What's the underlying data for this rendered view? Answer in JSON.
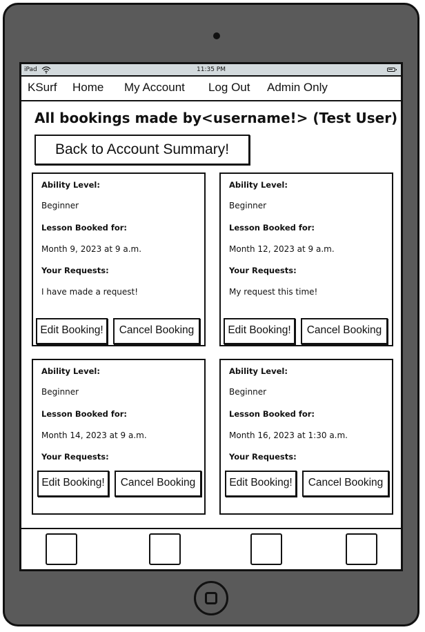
{
  "status_bar": {
    "device": "iPad",
    "time": "11:35 PM"
  },
  "nav": {
    "items": [
      "KSurf",
      "Home",
      "My Account",
      "Log Out",
      "Admin Only"
    ]
  },
  "page": {
    "title": "All bookings made by<username!> (Test User)",
    "back_button": "Back to Account Summary!"
  },
  "labels": {
    "ability": "Ability Level:",
    "lesson": "Lesson Booked for:",
    "requests": "Your Requests:",
    "edit": "Edit Booking!",
    "cancel": "Cancel Booking"
  },
  "bookings": [
    {
      "ability": "Beginner",
      "date": "Month 9, 2023 at 9 a.m.",
      "request": "I have made a request!"
    },
    {
      "ability": "Beginner",
      "date": "Month 12, 2023 at 9 a.m.",
      "request": "My request this time!"
    },
    {
      "ability": "Beginner",
      "date": "Month 14, 2023 at 9 a.m.",
      "request": ""
    },
    {
      "ability": "Beginner",
      "date": "Month 16, 2023 at 1:30 a.m.",
      "request": ""
    }
  ]
}
